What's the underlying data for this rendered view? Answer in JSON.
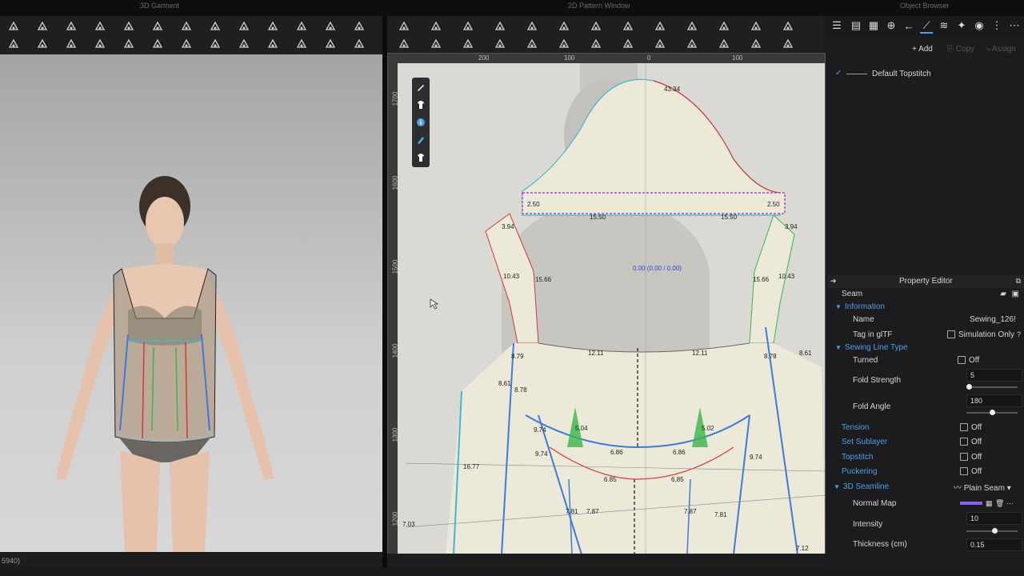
{
  "app": {
    "window_titles": [
      "3D Garment",
      "2D Pattern Window",
      "Object Browser"
    ]
  },
  "toolbar3d_icons": [
    "move-tool-icon",
    "select-tool-icon",
    "transform-icon",
    "fold-icon",
    "pin-icon",
    "tack-icon",
    "brush-icon",
    "arrange-icon",
    "avatar-icon",
    "garment-icon",
    "lock-icon",
    "settings-icon",
    "simulate-icon"
  ],
  "toolbar2d_icons": [
    "edit-pattern-icon",
    "edit-curve-icon",
    "polygon-icon",
    "rectangle-icon",
    "circle-icon",
    "dart-icon",
    "segment-sewing-icon",
    "free-sewing-icon",
    "text-icon",
    "annotation-icon",
    "grading-icon",
    "fold-icon",
    "ruler-icon"
  ],
  "ruler": {
    "h_labels": [
      "200",
      "100",
      "0",
      "100"
    ],
    "v_labels": [
      "1700",
      "1600",
      "1500",
      "1400",
      "1300",
      "1200"
    ]
  },
  "pattern": {
    "measure_labels": [
      "43.34",
      "2.50",
      "2.50",
      "15.50",
      "15.50",
      "3.94",
      "3.94",
      "10.43",
      "15.66",
      "15.66",
      "10.43",
      "12.11",
      "12.11",
      "8.79",
      "8.78",
      "8.61",
      "8.61",
      "8.78",
      "9.74",
      "9.74",
      "5.04",
      "5.02",
      "6.86",
      "6.86",
      "9.74",
      "16.77",
      "6.85",
      "6.85",
      "7.81",
      "7.87",
      "7.87",
      "7.81",
      "7.03",
      "7.12"
    ],
    "center_readout": "0.00 (0.00 / 0.00)"
  },
  "right_panel": {
    "add_label": "Add",
    "copy_label": "Copy",
    "assign_label": "Assign",
    "topstitch_item": "Default Topstitch",
    "property_editor_title": "Property Editor",
    "object_type": "Seam",
    "information_header": "Information",
    "name_label": "Name",
    "name_value": "Sewing_126!",
    "tag_label": "Tag in glTF",
    "simulation_only": "Simulation Only",
    "sewing_line_type_header": "Sewing Line Type",
    "turned_label": "Turned",
    "turned_value": "Off",
    "fold_strength_label": "Fold Strength",
    "fold_strength_value": "5",
    "fold_strength_level": 0.05,
    "fold_angle_label": "Fold Angle",
    "fold_angle_value": "180",
    "fold_angle_level": 0.5,
    "tension_label": "Tension",
    "tension_value": "Off",
    "sublayer_label": "Set Sublayer",
    "sublayer_value": "Off",
    "topstitch_label": "Topstitch",
    "topstitch_value": "Off",
    "puckering_label": "Puckering",
    "puckering_value": "Off",
    "seamline_header": "3D Seamline",
    "seamline_type": "Plain Seam",
    "normal_map_label": "Normal Map",
    "intensity_label": "Intensity",
    "intensity_value": "10",
    "intensity_level": 0.55,
    "thickness_label": "Thickness (cm)",
    "thickness_value": "0.15"
  },
  "status": {
    "left_text": "5940)"
  },
  "colors": {
    "accent": "#4f9fe8",
    "seam_blue": "#3d7bd9",
    "seam_red": "#d23a3a",
    "seam_green": "#39b54a",
    "seam_cyan": "#3fb7d6",
    "normal_map": "#8b5cf6"
  }
}
